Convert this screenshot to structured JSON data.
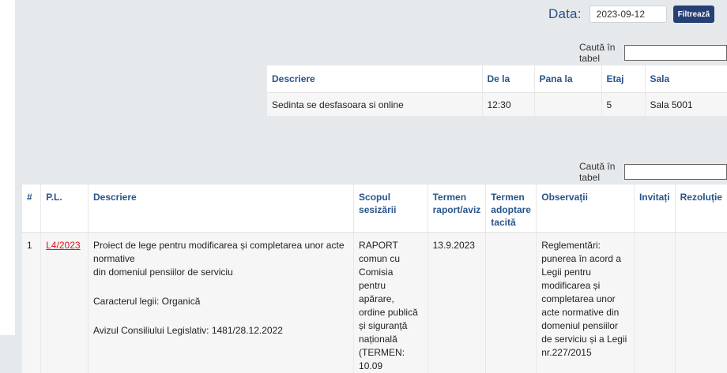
{
  "filter": {
    "date_label": "Data:",
    "date_value": "2023-09-12",
    "button_label": "Filtrează"
  },
  "search1": {
    "label": "Caută în tabel",
    "value": ""
  },
  "sessions": {
    "headers": [
      "Descriere",
      "De la",
      "Pana la",
      "Etaj",
      "Sala"
    ],
    "rows": [
      {
        "descriere": "Sedinta se desfasoara si online",
        "de_la": "12:30",
        "pana_la": "",
        "etaj": "5",
        "sala": "Sala 5001"
      }
    ]
  },
  "search2": {
    "label": "Caută în tabel",
    "value": ""
  },
  "agenda": {
    "headers": {
      "nr": "#",
      "pl": "P.L.",
      "descriere": "Descriere",
      "scop": "Scopul sesizării",
      "termen_raport_1": "Termen",
      "termen_raport_2": "raport/aviz",
      "termen_adoptare_1": "Termen",
      "termen_adoptare_2": "adoptare",
      "termen_adoptare_3": "tacită",
      "observatii": "Observații",
      "invitati": "Invitați",
      "rezolutie": "Rezoluție"
    },
    "rows": [
      {
        "nr": "1",
        "pl": "L4/2023",
        "descriere_1": "Proiect de lege pentru modificarea și completarea unor acte normative",
        "descriere_2": "din domeniul pensiilor de serviciu",
        "caracter": "Caracterul legii: Organică",
        "aviz": "Avizul Consiliului Legislativ: 1481/28.12.2022",
        "scop": "RAPORT comun cu Comisia pentru apărare, ordine publică și siguranță națională (TERMEN: 10.09",
        "termen_raport": "13.9.2023",
        "termen_adoptare": "",
        "observatii": "Reglementări: punerea în acord a Legii pentru modificarea și completarea unor acte normative din domeniul pensiilor de serviciu și a Legii nr.227/2015",
        "invitati": "",
        "rezolutie": ""
      }
    ]
  }
}
